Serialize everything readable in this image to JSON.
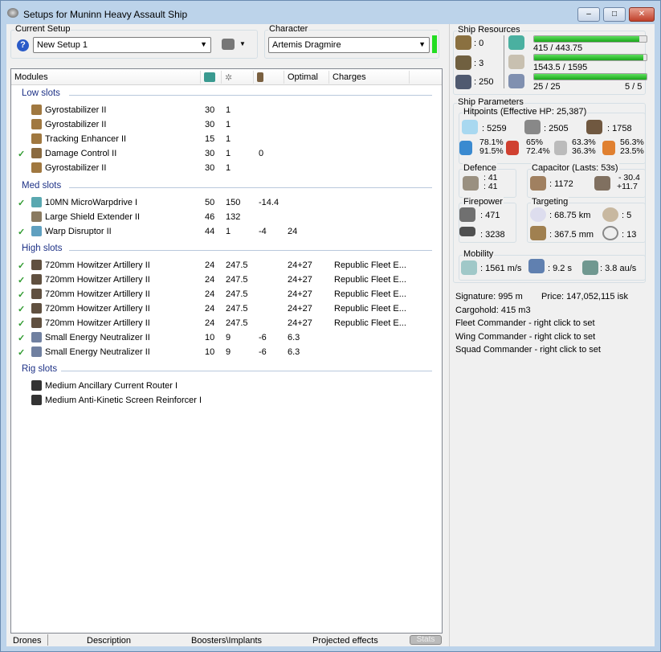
{
  "window": {
    "title": "Setups for Muninn Heavy Assault Ship",
    "min": "–",
    "max": "□",
    "close": "✕"
  },
  "setup": {
    "label": "Current Setup",
    "value": "New Setup 1",
    "help": "?"
  },
  "character": {
    "label": "Character",
    "value": "Artemis Dragmire",
    "status_color": "#22dd22"
  },
  "columns": [
    "Modules",
    "",
    "",
    "",
    "Optimal",
    "Charges"
  ],
  "sections": [
    {
      "title": "Low slots",
      "rows": [
        {
          "checked": false,
          "name": "Gyrostabilizer II",
          "c1": "30",
          "c2": "1",
          "c3": "",
          "opt": "",
          "charge": "",
          "color": "#a07840"
        },
        {
          "checked": false,
          "name": "Gyrostabilizer II",
          "c1": "30",
          "c2": "1",
          "c3": "",
          "opt": "",
          "charge": "",
          "color": "#a07840"
        },
        {
          "checked": false,
          "name": "Tracking Enhancer II",
          "c1": "15",
          "c2": "1",
          "c3": "",
          "opt": "",
          "charge": "",
          "color": "#a07840"
        },
        {
          "checked": true,
          "name": "Damage Control II",
          "c1": "30",
          "c2": "1",
          "c3": "0",
          "opt": "",
          "charge": "",
          "color": "#8a6a40"
        },
        {
          "checked": false,
          "name": "Gyrostabilizer II",
          "c1": "30",
          "c2": "1",
          "c3": "",
          "opt": "",
          "charge": "",
          "color": "#a07840"
        }
      ]
    },
    {
      "title": "Med slots",
      "rows": [
        {
          "checked": true,
          "name": "10MN MicroWarpdrive I",
          "c1": "50",
          "c2": "150",
          "c3": "-14.4",
          "opt": "",
          "charge": "",
          "color": "#5aa8b0"
        },
        {
          "checked": false,
          "name": "Large Shield Extender II",
          "c1": "46",
          "c2": "132",
          "c3": "",
          "opt": "",
          "charge": "",
          "color": "#8a7a60"
        },
        {
          "checked": true,
          "name": "Warp Disruptor II",
          "c1": "44",
          "c2": "1",
          "c3": "-4",
          "opt": "24",
          "charge": "",
          "color": "#60a0c0"
        }
      ]
    },
    {
      "title": "High slots",
      "rows": [
        {
          "checked": true,
          "name": "720mm Howitzer Artillery II",
          "c1": "24",
          "c2": "247.5",
          "c3": "",
          "opt": "24+27",
          "charge": "Republic Fleet E...",
          "color": "#605040"
        },
        {
          "checked": true,
          "name": "720mm Howitzer Artillery II",
          "c1": "24",
          "c2": "247.5",
          "c3": "",
          "opt": "24+27",
          "charge": "Republic Fleet E...",
          "color": "#605040"
        },
        {
          "checked": true,
          "name": "720mm Howitzer Artillery II",
          "c1": "24",
          "c2": "247.5",
          "c3": "",
          "opt": "24+27",
          "charge": "Republic Fleet E...",
          "color": "#605040"
        },
        {
          "checked": true,
          "name": "720mm Howitzer Artillery II",
          "c1": "24",
          "c2": "247.5",
          "c3": "",
          "opt": "24+27",
          "charge": "Republic Fleet E...",
          "color": "#605040"
        },
        {
          "checked": true,
          "name": "720mm Howitzer Artillery II",
          "c1": "24",
          "c2": "247.5",
          "c3": "",
          "opt": "24+27",
          "charge": "Republic Fleet E...",
          "color": "#605040"
        },
        {
          "checked": true,
          "name": "Small Energy Neutralizer II",
          "c1": "10",
          "c2": "9",
          "c3": "-6",
          "opt": "6.3",
          "charge": "",
          "color": "#7080a0"
        },
        {
          "checked": true,
          "name": "Small Energy Neutralizer II",
          "c1": "10",
          "c2": "9",
          "c3": "-6",
          "opt": "6.3",
          "charge": "",
          "color": "#7080a0"
        }
      ]
    },
    {
      "title": "Rig slots",
      "rows": [
        {
          "checked": false,
          "name": "Medium Ancillary Current Router I",
          "c1": "",
          "c2": "",
          "c3": "",
          "opt": "",
          "charge": "",
          "color": "#333"
        },
        {
          "checked": false,
          "name": "Medium Anti-Kinetic Screen Reinforcer I",
          "c1": "",
          "c2": "",
          "c3": "",
          "opt": "",
          "charge": "",
          "color": "#333"
        }
      ]
    }
  ],
  "tabs": {
    "drones": "Drones",
    "description": "Description",
    "boosters": "Boosters\\Implants",
    "projected": "Projected effects",
    "stats": "Stats"
  },
  "resources": {
    "label": "Ship Resources",
    "turrets": ": 0",
    "launchers": ": 3",
    "drone_bay": ": 250",
    "cpu": "415 / 443.75",
    "cpu_fill": 0.935,
    "power": "1543.5 / 1595",
    "power_fill": 0.968,
    "bandwidth": "25 / 25",
    "bandwidth_fill": 1.0,
    "drones": "5 / 5"
  },
  "params": {
    "label": "Ship Parameters",
    "hp_label": "Hitpoints (Effective HP: 25,387)",
    "shield": ": 5259",
    "armor": ": 2505",
    "structure": ": 1758",
    "res": [
      [
        "78.1%",
        "91.5%"
      ],
      [
        "65%",
        "72.4%"
      ],
      [
        "63.3%",
        "36.3%"
      ],
      [
        "56.3%",
        "23.5%"
      ]
    ],
    "defence_label": "Defence",
    "def1": ": 41",
    "def2": ": 41",
    "cap_label": "Capacitor (Lasts: 53s)",
    "cap": ": 1172",
    "cap_use": "- 30.4",
    "cap_regen": "+11.7",
    "fire_label": "Firepower",
    "dps": ": 471",
    "volley": ": 3238",
    "target_label": "Targeting",
    "range": ": 68.75 km",
    "maxtargets": ": 5",
    "scanres": ": 367.5 mm",
    "sensor": ": 13",
    "mob_label": "Mobility",
    "speed": ": 1561 m/s",
    "align": ": 9.2 s",
    "warp": ": 3.8 au/s"
  },
  "info": {
    "signature": "Signature: 995 m",
    "price": "Price: 147,052,115 isk",
    "cargo": "Cargohold: 415 m3",
    "fleet": "Fleet Commander - right click to set",
    "wing": "Wing Commander - right click to set",
    "squad": "Squad Commander - right click to set"
  }
}
